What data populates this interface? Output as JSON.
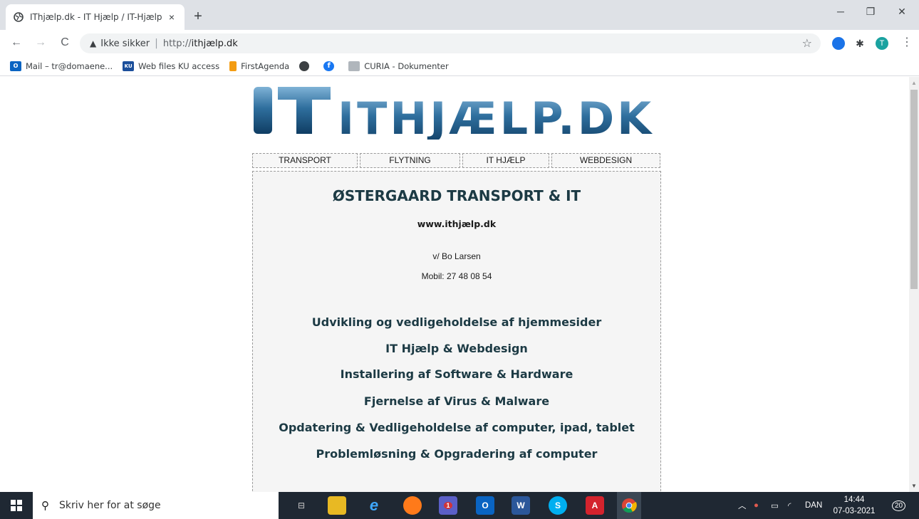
{
  "browser": {
    "tab_title": "IThjælp.dk - IT Hjælp / IT-Hjælp",
    "tab_close": "×",
    "new_tab": "+",
    "security_label": "Ikke sikker",
    "url_prefix": "http://",
    "url_host": "ithjælp.dk",
    "profile_initial": "T"
  },
  "bookmarks": [
    {
      "label": "Mail – tr@domaene...",
      "icon": "outlook-icon"
    },
    {
      "label": "Web files KU access",
      "icon": "ku-icon"
    },
    {
      "label": "FirstAgenda",
      "icon": "firstagenda-icon"
    },
    {
      "label": "",
      "icon": "globe-icon"
    },
    {
      "label": "",
      "icon": "facebook-icon"
    },
    {
      "label": "CURIA - Dokumenter",
      "icon": "curia-icon"
    }
  ],
  "page": {
    "logo_text": "ITHJÆLP.DK",
    "nav": [
      "TRANSPORT",
      "FLYTNING",
      "IT HJÆLP",
      "WEBDESIGN"
    ],
    "company": "ØSTERGAARD TRANSPORT & IT",
    "website": "www.ithjælp.dk",
    "owner": "v/ Bo Larsen",
    "phone": "Mobil: 27 48 08 54",
    "services": [
      "Udvikling og vedligeholdelse af hjemmesider",
      "IT Hjælp & Webdesign",
      "Installering af Software & Hardware",
      "Fjernelse af Virus & Malware",
      "Opdatering & Vedligeholdelse af computer, ipad, tablet",
      "Problemløsning & Opgradering af computer"
    ]
  },
  "taskbar": {
    "search_placeholder": "Skriv her for at søge",
    "language": "DAN",
    "time": "14:44",
    "date": "07-03-2021",
    "notification_count": "20",
    "teams_badge": "1"
  },
  "colors": {
    "heading": "#1c3a44",
    "taskbar": "#1f2833",
    "tabstrip": "#dee1e6"
  }
}
